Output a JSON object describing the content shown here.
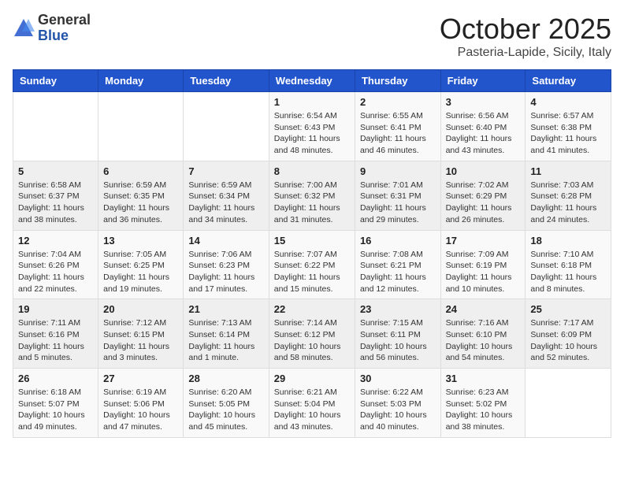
{
  "logo": {
    "general": "General",
    "blue": "Blue"
  },
  "header": {
    "month": "October 2025",
    "location": "Pasteria-Lapide, Sicily, Italy"
  },
  "weekdays": [
    "Sunday",
    "Monday",
    "Tuesday",
    "Wednesday",
    "Thursday",
    "Friday",
    "Saturday"
  ],
  "weeks": [
    [
      {
        "day": "",
        "info": ""
      },
      {
        "day": "",
        "info": ""
      },
      {
        "day": "",
        "info": ""
      },
      {
        "day": "1",
        "info": "Sunrise: 6:54 AM\nSunset: 6:43 PM\nDaylight: 11 hours\nand 48 minutes."
      },
      {
        "day": "2",
        "info": "Sunrise: 6:55 AM\nSunset: 6:41 PM\nDaylight: 11 hours\nand 46 minutes."
      },
      {
        "day": "3",
        "info": "Sunrise: 6:56 AM\nSunset: 6:40 PM\nDaylight: 11 hours\nand 43 minutes."
      },
      {
        "day": "4",
        "info": "Sunrise: 6:57 AM\nSunset: 6:38 PM\nDaylight: 11 hours\nand 41 minutes."
      }
    ],
    [
      {
        "day": "5",
        "info": "Sunrise: 6:58 AM\nSunset: 6:37 PM\nDaylight: 11 hours\nand 38 minutes."
      },
      {
        "day": "6",
        "info": "Sunrise: 6:59 AM\nSunset: 6:35 PM\nDaylight: 11 hours\nand 36 minutes."
      },
      {
        "day": "7",
        "info": "Sunrise: 6:59 AM\nSunset: 6:34 PM\nDaylight: 11 hours\nand 34 minutes."
      },
      {
        "day": "8",
        "info": "Sunrise: 7:00 AM\nSunset: 6:32 PM\nDaylight: 11 hours\nand 31 minutes."
      },
      {
        "day": "9",
        "info": "Sunrise: 7:01 AM\nSunset: 6:31 PM\nDaylight: 11 hours\nand 29 minutes."
      },
      {
        "day": "10",
        "info": "Sunrise: 7:02 AM\nSunset: 6:29 PM\nDaylight: 11 hours\nand 26 minutes."
      },
      {
        "day": "11",
        "info": "Sunrise: 7:03 AM\nSunset: 6:28 PM\nDaylight: 11 hours\nand 24 minutes."
      }
    ],
    [
      {
        "day": "12",
        "info": "Sunrise: 7:04 AM\nSunset: 6:26 PM\nDaylight: 11 hours\nand 22 minutes."
      },
      {
        "day": "13",
        "info": "Sunrise: 7:05 AM\nSunset: 6:25 PM\nDaylight: 11 hours\nand 19 minutes."
      },
      {
        "day": "14",
        "info": "Sunrise: 7:06 AM\nSunset: 6:23 PM\nDaylight: 11 hours\nand 17 minutes."
      },
      {
        "day": "15",
        "info": "Sunrise: 7:07 AM\nSunset: 6:22 PM\nDaylight: 11 hours\nand 15 minutes."
      },
      {
        "day": "16",
        "info": "Sunrise: 7:08 AM\nSunset: 6:21 PM\nDaylight: 11 hours\nand 12 minutes."
      },
      {
        "day": "17",
        "info": "Sunrise: 7:09 AM\nSunset: 6:19 PM\nDaylight: 11 hours\nand 10 minutes."
      },
      {
        "day": "18",
        "info": "Sunrise: 7:10 AM\nSunset: 6:18 PM\nDaylight: 11 hours\nand 8 minutes."
      }
    ],
    [
      {
        "day": "19",
        "info": "Sunrise: 7:11 AM\nSunset: 6:16 PM\nDaylight: 11 hours\nand 5 minutes."
      },
      {
        "day": "20",
        "info": "Sunrise: 7:12 AM\nSunset: 6:15 PM\nDaylight: 11 hours\nand 3 minutes."
      },
      {
        "day": "21",
        "info": "Sunrise: 7:13 AM\nSunset: 6:14 PM\nDaylight: 11 hours\nand 1 minute."
      },
      {
        "day": "22",
        "info": "Sunrise: 7:14 AM\nSunset: 6:12 PM\nDaylight: 10 hours\nand 58 minutes."
      },
      {
        "day": "23",
        "info": "Sunrise: 7:15 AM\nSunset: 6:11 PM\nDaylight: 10 hours\nand 56 minutes."
      },
      {
        "day": "24",
        "info": "Sunrise: 7:16 AM\nSunset: 6:10 PM\nDaylight: 10 hours\nand 54 minutes."
      },
      {
        "day": "25",
        "info": "Sunrise: 7:17 AM\nSunset: 6:09 PM\nDaylight: 10 hours\nand 52 minutes."
      }
    ],
    [
      {
        "day": "26",
        "info": "Sunrise: 6:18 AM\nSunset: 5:07 PM\nDaylight: 10 hours\nand 49 minutes."
      },
      {
        "day": "27",
        "info": "Sunrise: 6:19 AM\nSunset: 5:06 PM\nDaylight: 10 hours\nand 47 minutes."
      },
      {
        "day": "28",
        "info": "Sunrise: 6:20 AM\nSunset: 5:05 PM\nDaylight: 10 hours\nand 45 minutes."
      },
      {
        "day": "29",
        "info": "Sunrise: 6:21 AM\nSunset: 5:04 PM\nDaylight: 10 hours\nand 43 minutes."
      },
      {
        "day": "30",
        "info": "Sunrise: 6:22 AM\nSunset: 5:03 PM\nDaylight: 10 hours\nand 40 minutes."
      },
      {
        "day": "31",
        "info": "Sunrise: 6:23 AM\nSunset: 5:02 PM\nDaylight: 10 hours\nand 38 minutes."
      },
      {
        "day": "",
        "info": ""
      }
    ]
  ]
}
